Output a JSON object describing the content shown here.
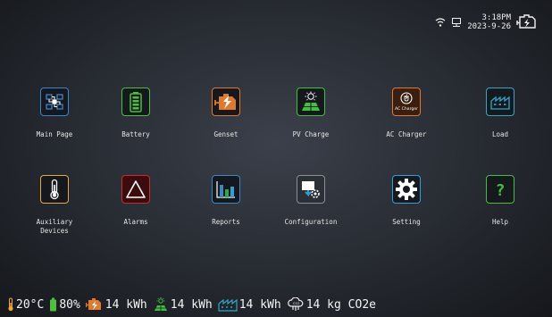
{
  "status": {
    "time": "3:18PM",
    "date": "2023-9-26"
  },
  "tiles": [
    {
      "label": "Main Page",
      "icon": "main-page-icon",
      "color": "#3a86c8"
    },
    {
      "label": "Battery",
      "icon": "battery-icon",
      "color": "#4cbf3c"
    },
    {
      "label": "Genset",
      "icon": "genset-icon",
      "color": "#e07a2a"
    },
    {
      "label": "PV Charge",
      "icon": "pv-charge-icon",
      "color": "#3cc23c"
    },
    {
      "label": "AC Charger",
      "icon": "ac-charger-icon",
      "color": "#e07a2a",
      "icon_text": "AC Charger"
    },
    {
      "label": "Load",
      "icon": "load-icon",
      "color": "#2fa8c8"
    },
    {
      "label": "Auxiliary\nDevices",
      "icon": "thermometer-icon",
      "color": "#e8a83a"
    },
    {
      "label": "Alarms",
      "icon": "alarm-icon",
      "color": "#cc2b2b"
    },
    {
      "label": "Reports",
      "icon": "reports-icon",
      "color": "#3a86c8"
    },
    {
      "label": "Configuration",
      "icon": "configuration-icon",
      "color": "#8a8f98"
    },
    {
      "label": "Setting",
      "icon": "setting-icon",
      "color": "#2fa0d8"
    },
    {
      "label": "Help",
      "icon": "help-icon",
      "color": "#3cc23c"
    }
  ],
  "bottom": {
    "temperature": "20°C",
    "battery": "80%",
    "genset_energy": "14 kWh",
    "pv_energy": "14 kWh",
    "load_energy": "14 kWh",
    "co2": "14 kg CO2e"
  }
}
